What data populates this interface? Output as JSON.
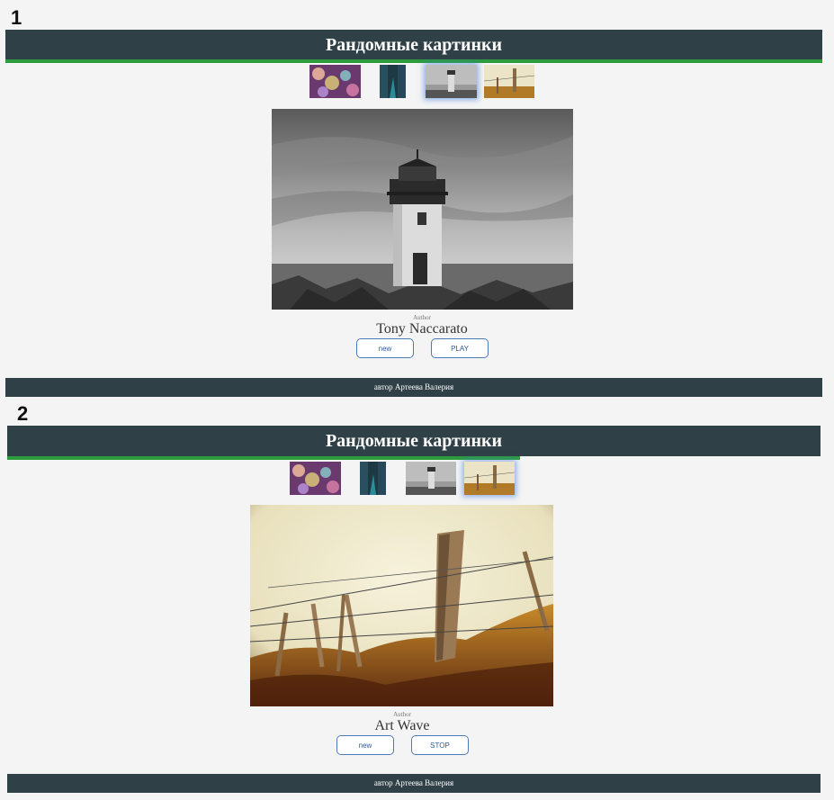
{
  "panels": [
    {
      "step": "1",
      "header_title": "Рандомные картинки",
      "progress": 1.0,
      "thumbnails": [
        {
          "name": "bokeh-thumbnail",
          "active": false
        },
        {
          "name": "street-thumbnail",
          "active": false
        },
        {
          "name": "lighthouse-thumbnail",
          "active": true
        },
        {
          "name": "fence-thumbnail",
          "active": false
        }
      ],
      "main_image": "lighthouse",
      "author_label": "Author",
      "author_name": "Tony Naccarato",
      "new_button": "new",
      "play_button": "PLAY",
      "footer_text": "автор Артеева Валерия"
    },
    {
      "step": "2",
      "header_title": "Рандомные картинки",
      "progress": 0.63,
      "thumbnails": [
        {
          "name": "bokeh-thumbnail",
          "active": false
        },
        {
          "name": "street-thumbnail",
          "active": false
        },
        {
          "name": "lighthouse-thumbnail",
          "active": false
        },
        {
          "name": "fence-thumbnail",
          "active": true
        }
      ],
      "main_image": "fence",
      "author_label": "Author",
      "author_name": "Art Wave",
      "new_button": "new",
      "play_button": "STOP",
      "footer_text": "автор Артеева Валерия"
    }
  ],
  "colors": {
    "header_bg": "#2f4047",
    "progress": "#2d9c3c",
    "button_border": "#4a7ab8"
  }
}
